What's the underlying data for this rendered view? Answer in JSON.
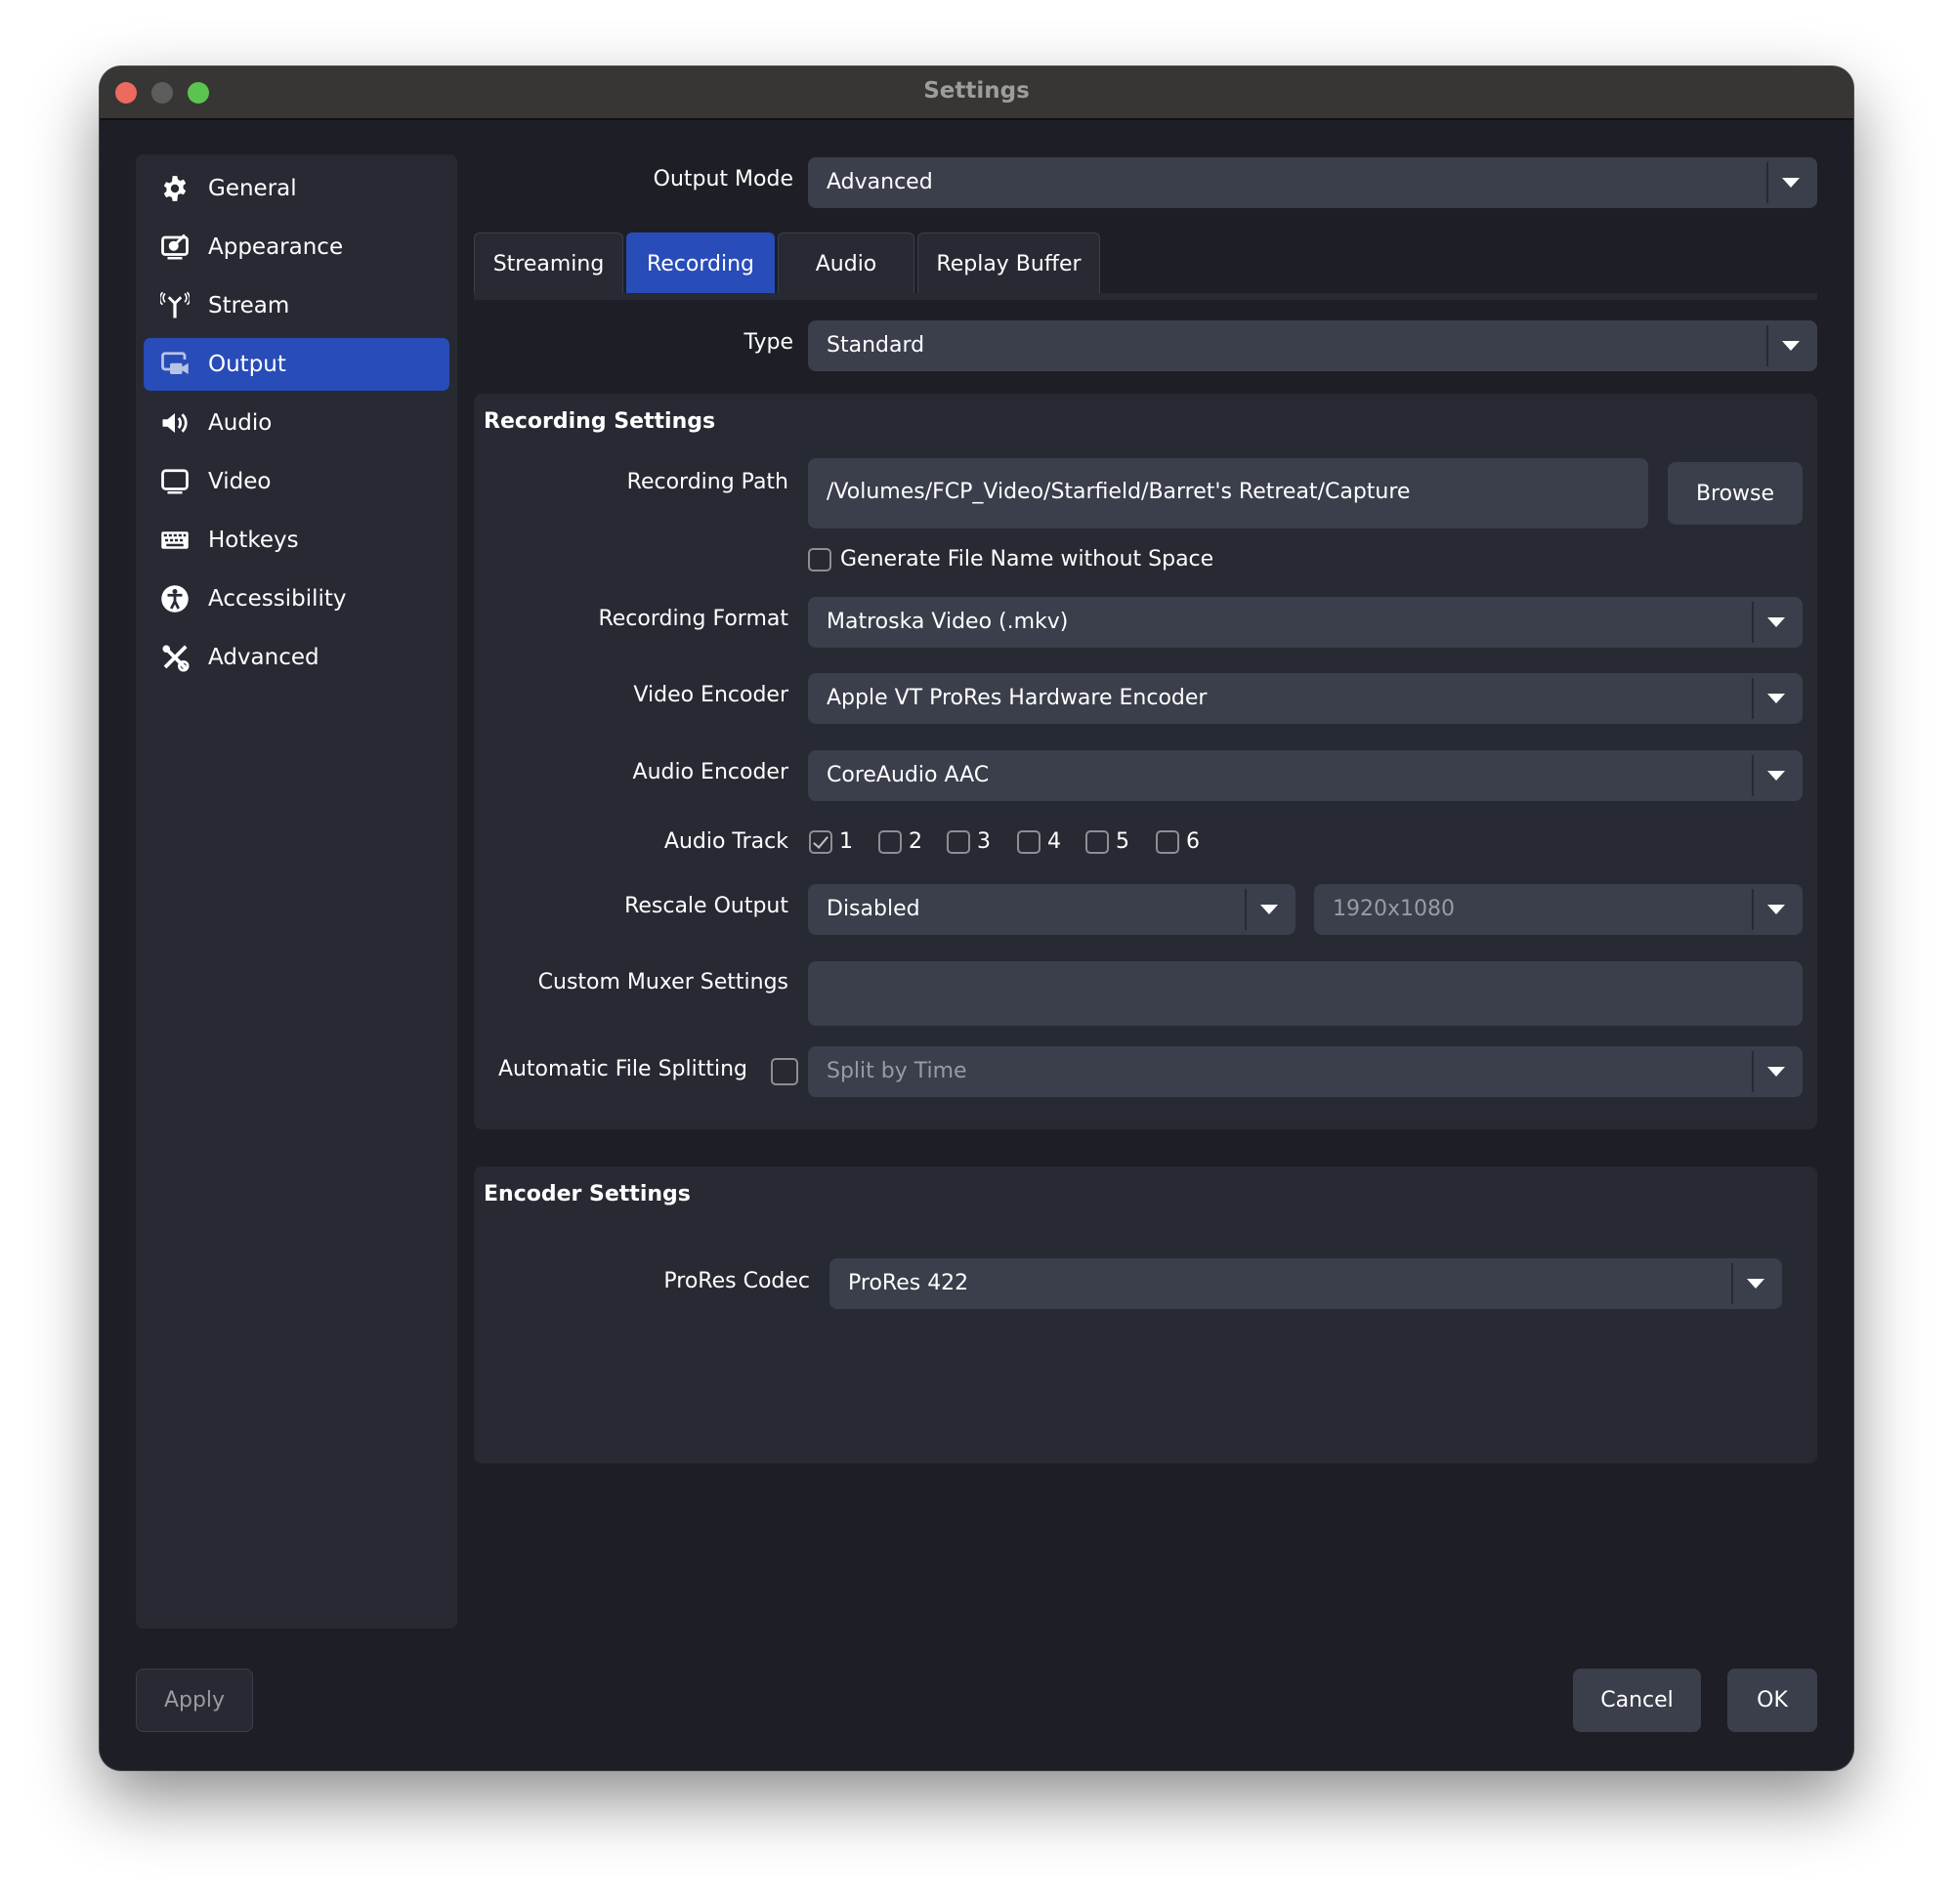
{
  "window": {
    "title": "Settings"
  },
  "sidebar": {
    "items": [
      {
        "label": "General",
        "icon": "gear-icon"
      },
      {
        "label": "Appearance",
        "icon": "appearance-icon"
      },
      {
        "label": "Stream",
        "icon": "antenna-icon"
      },
      {
        "label": "Output",
        "icon": "output-icon",
        "active": true
      },
      {
        "label": "Audio",
        "icon": "speaker-icon"
      },
      {
        "label": "Video",
        "icon": "monitor-icon"
      },
      {
        "label": "Hotkeys",
        "icon": "keyboard-icon"
      },
      {
        "label": "Accessibility",
        "icon": "accessibility-icon"
      },
      {
        "label": "Advanced",
        "icon": "tools-icon"
      }
    ]
  },
  "output_mode": {
    "label": "Output Mode",
    "value": "Advanced"
  },
  "tabs": [
    {
      "label": "Streaming"
    },
    {
      "label": "Recording",
      "active": true
    },
    {
      "label": "Audio"
    },
    {
      "label": "Replay Buffer"
    }
  ],
  "type": {
    "label": "Type",
    "value": "Standard"
  },
  "recording_settings": {
    "title": "Recording Settings",
    "path": {
      "label": "Recording Path",
      "value": "/Volumes/FCP_Video/Starfield/Barret's Retreat/Capture",
      "browse_label": "Browse"
    },
    "no_space": {
      "label": "Generate File Name without Space",
      "checked": false
    },
    "format": {
      "label": "Recording Format",
      "value": "Matroska Video (.mkv)"
    },
    "video_encoder": {
      "label": "Video Encoder",
      "value": "Apple VT ProRes Hardware Encoder"
    },
    "audio_encoder": {
      "label": "Audio Encoder",
      "value": "CoreAudio AAC"
    },
    "audio_track": {
      "label": "Audio Track",
      "tracks": [
        {
          "label": "1",
          "checked": true
        },
        {
          "label": "2",
          "checked": false
        },
        {
          "label": "3",
          "checked": false
        },
        {
          "label": "4",
          "checked": false
        },
        {
          "label": "5",
          "checked": false
        },
        {
          "label": "6",
          "checked": false
        }
      ]
    },
    "rescale": {
      "label": "Rescale Output",
      "value": "Disabled",
      "resolution": "1920x1080"
    },
    "muxer": {
      "label": "Custom Muxer Settings",
      "value": ""
    },
    "splitting": {
      "label": "Automatic File Splitting",
      "checked": false,
      "value": "Split by Time"
    }
  },
  "encoder_settings": {
    "title": "Encoder Settings",
    "codec": {
      "label": "ProRes Codec",
      "value": "ProRes 422"
    }
  },
  "footer": {
    "apply": "Apply",
    "cancel": "Cancel",
    "ok": "OK"
  },
  "colors": {
    "accent": "#284cb8",
    "window_bg": "#1e1f26",
    "panel_bg": "#272a33",
    "control_bg": "#3b3e4b"
  }
}
